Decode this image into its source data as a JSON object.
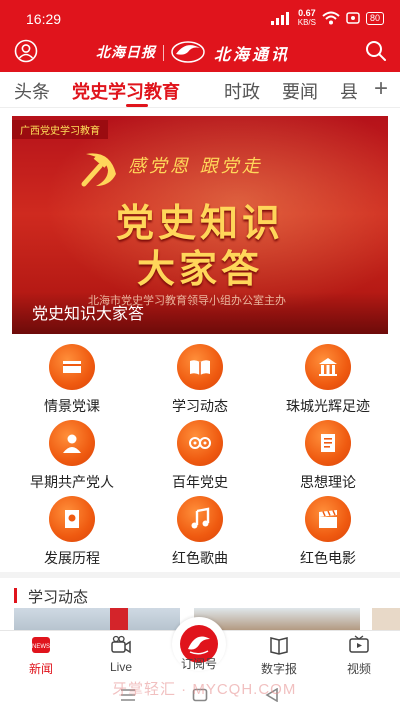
{
  "status": {
    "time": "16:29",
    "speed_value": "0.67",
    "speed_unit": "KB/S",
    "battery": "80"
  },
  "header": {
    "brand_left": "北海日报",
    "brand_right": "北海通讯"
  },
  "tabs": [
    {
      "label": "头条",
      "active": false
    },
    {
      "label": "党史学习教育",
      "active": true
    },
    {
      "label": "时政",
      "active": false
    },
    {
      "label": "要闻",
      "active": false
    },
    {
      "label": "县",
      "active": false
    }
  ],
  "banner": {
    "tag": "广西党史学习教育",
    "slogan": "感党恩 跟党走",
    "title_line1": "党史知识",
    "title_line2": "大家答",
    "sub": "北海市党史学习教育领导小组办公室主办",
    "caption": "党史知识大家答"
  },
  "grid": [
    {
      "label": "情景党课",
      "icon": "book-icon"
    },
    {
      "label": "学习动态",
      "icon": "open-book-icon"
    },
    {
      "label": "珠城光辉足迹",
      "icon": "monument-icon"
    },
    {
      "label": "早期共产党人",
      "icon": "portrait-icon"
    },
    {
      "label": "百年党史",
      "icon": "film-reel-icon"
    },
    {
      "label": "思想理论",
      "icon": "document-icon"
    },
    {
      "label": "发展历程",
      "icon": "party-book-icon"
    },
    {
      "label": "红色歌曲",
      "icon": "music-note-icon"
    },
    {
      "label": "红色电影",
      "icon": "clapperboard-icon"
    }
  ],
  "section": {
    "title": "学习动态"
  },
  "bottom_nav": [
    {
      "label": "新闻",
      "icon": "news-icon",
      "active": true
    },
    {
      "label": "Live",
      "icon": "video-camera-icon",
      "active": false
    },
    {
      "label": "订阅号",
      "icon": "dolphin-logo-icon",
      "active": false
    },
    {
      "label": "数字报",
      "icon": "newspaper-icon",
      "active": false
    },
    {
      "label": "视频",
      "icon": "tv-icon",
      "active": false
    }
  ],
  "watermark": "牙掌轻汇 · MYCQH.COM",
  "colors": {
    "brand_red": "#e0141c",
    "icon_orange": "#ef5a10",
    "banner_gold": "#ffd65a"
  }
}
